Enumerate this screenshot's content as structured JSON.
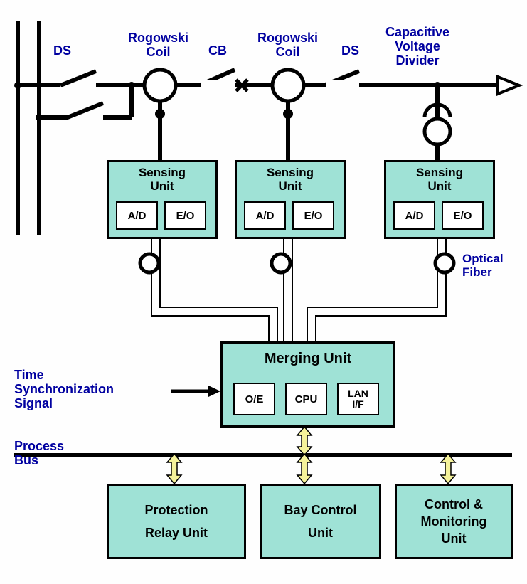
{
  "labels": {
    "ds1": "DS",
    "rogowski1": "Rogowski\nCoil",
    "cb": "CB",
    "rogowski2": "Rogowski\nCoil",
    "ds2": "DS",
    "cvd": "Capacitive\nVoltage\nDivider",
    "opticalFiber": "Optical\nFiber",
    "timeSync": "Time\nSynchronization\nSignal",
    "processBus": "Process\nBus"
  },
  "sensingUnit": {
    "title": "Sensing\nUnit",
    "ad": "A/D",
    "eo": "E/O"
  },
  "mergingUnit": {
    "title": "Merging Unit",
    "oe": "O/E",
    "cpu": "CPU",
    "lanif": "LAN\nI/F"
  },
  "bottomUnits": {
    "protection": "Protection\nRelay Unit",
    "bayControl": "Bay Control\nUnit",
    "controlMonitor": "Control &\nMonitoring\nUnit"
  }
}
